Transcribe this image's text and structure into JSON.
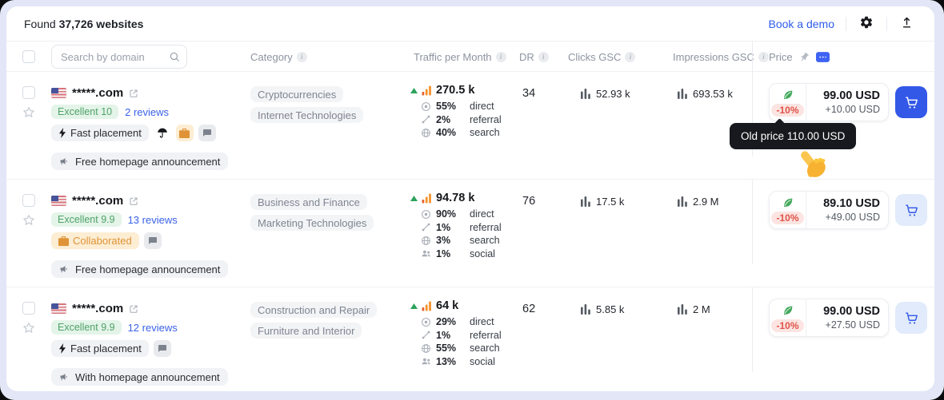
{
  "app": {
    "found_prefix": "Found",
    "found_count": "37,726 websites",
    "book_demo": "Book a demo"
  },
  "search": {
    "placeholder": "Search by domain"
  },
  "columns": {
    "category": "Category",
    "traffic": "Traffic per Month",
    "dr": "DR",
    "clicks": "Clicks GSC",
    "impressions": "Impressions GSC",
    "price": "Price"
  },
  "tooltip": {
    "text": "Old price 110.00 USD"
  },
  "colors": {
    "accent_blue": "#3358e8",
    "discount_red": "#e05247",
    "rating_green": "#4ea267",
    "badge_orange": "#df9336"
  },
  "rows": [
    {
      "country": "us-flag",
      "domain": "*****.com",
      "rating": "Excellent 10",
      "reviews": "2 reviews",
      "chips": [
        {
          "style": "gray",
          "icon": "lightning-icon",
          "label": "Fast placement"
        }
      ],
      "icon_buttons": [
        "umbrella-icon",
        "briefcase-icon",
        "comment-icon"
      ],
      "announcement": "Free homepage announcement",
      "categories": [
        "Cryptocurrencies",
        "Internet Technologies"
      ],
      "traffic": {
        "value": "270.5 k",
        "breakdown": [
          {
            "type": "direct",
            "pct": "55%",
            "label": "direct"
          },
          {
            "type": "referral",
            "pct": "2%",
            "label": "referral"
          },
          {
            "type": "search",
            "pct": "40%",
            "label": "search"
          }
        ]
      },
      "dr": "34",
      "clicks": "52.93 k",
      "impressions": "693.53 k",
      "price": {
        "discount": "-10%",
        "amount": "99.00 USD",
        "extra": "+10.00 USD"
      },
      "cart_variant": "solid",
      "show_tooltip": true
    },
    {
      "country": "us-flag",
      "domain": "*****.com",
      "rating": "Excellent 9.9",
      "reviews": "13 reviews",
      "chips": [
        {
          "style": "orange",
          "icon": "briefcase-icon",
          "label": "Collaborated"
        }
      ],
      "icon_buttons": [
        "comment-icon"
      ],
      "announcement": "Free homepage announcement",
      "categories": [
        "Business and Finance",
        "Marketing Technologies"
      ],
      "traffic": {
        "value": "94.78 k",
        "breakdown": [
          {
            "type": "direct",
            "pct": "90%",
            "label": "direct"
          },
          {
            "type": "referral",
            "pct": "1%",
            "label": "referral"
          },
          {
            "type": "search",
            "pct": "3%",
            "label": "search"
          },
          {
            "type": "social",
            "pct": "1%",
            "label": "social"
          }
        ]
      },
      "dr": "76",
      "clicks": "17.5 k",
      "impressions": "2.9 M",
      "price": {
        "discount": "-10%",
        "amount": "89.10 USD",
        "extra": "+49.00 USD"
      },
      "cart_variant": "light",
      "show_tooltip": false
    },
    {
      "country": "us-flag",
      "domain": "*****.com",
      "rating": "Excellent 9.9",
      "reviews": "12 reviews",
      "chips": [
        {
          "style": "gray",
          "icon": "lightning-icon",
          "label": "Fast placement"
        }
      ],
      "icon_buttons": [
        "comment-icon"
      ],
      "announcement": "With homepage announcement",
      "categories": [
        "Construction and Repair",
        "Furniture and Interior"
      ],
      "traffic": {
        "value": "64 k",
        "breakdown": [
          {
            "type": "direct",
            "pct": "29%",
            "label": "direct"
          },
          {
            "type": "referral",
            "pct": "1%",
            "label": "referral"
          },
          {
            "type": "search",
            "pct": "55%",
            "label": "search"
          },
          {
            "type": "social",
            "pct": "13%",
            "label": "social"
          }
        ]
      },
      "dr": "62",
      "clicks": "5.85 k",
      "impressions": "2 M",
      "price": {
        "discount": "-10%",
        "amount": "99.00 USD",
        "extra": "+27.50 USD"
      },
      "cart_variant": "light",
      "show_tooltip": false
    }
  ]
}
